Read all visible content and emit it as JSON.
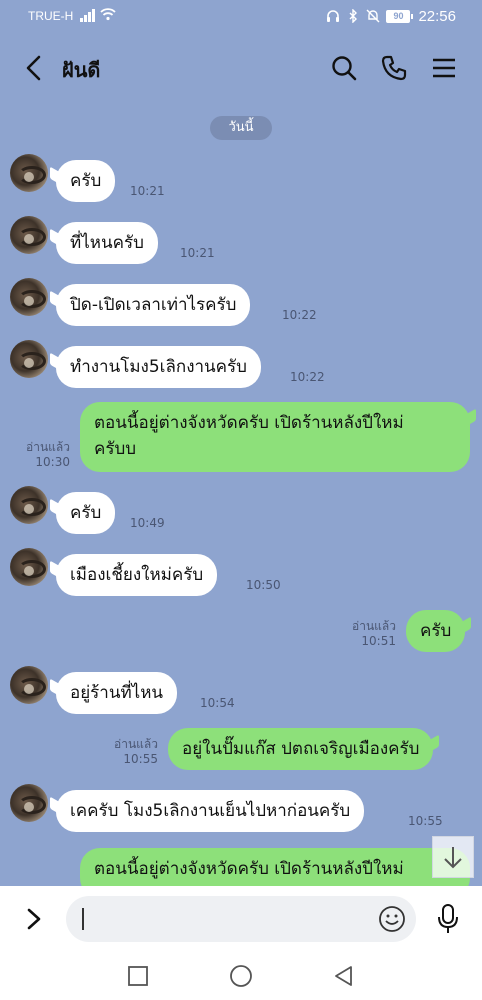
{
  "status_bar": {
    "carrier": "TRUE-H",
    "battery": "90",
    "time": "22:56"
  },
  "header": {
    "title": "ฝันดี"
  },
  "date_chip": "วันนี้",
  "messages": [
    {
      "dir": "in",
      "text": "ครับ",
      "time": "10:21"
    },
    {
      "dir": "in",
      "text": "ที่ไหนครับ",
      "time": "10:21"
    },
    {
      "dir": "in",
      "text": "ปิด-เปิดเวลาเท่าไรครับ",
      "time": "10:22"
    },
    {
      "dir": "in",
      "text": "ทำงานโมง5เลิกงานครับ",
      "time": "10:22"
    },
    {
      "dir": "out",
      "line1": "ตอนนี้อยู่ต่างจังหวัดครับ เปิดร้านหลังปีใหม่",
      "line2": "ครับบ",
      "read": "อ่านแล้ว",
      "time": "10:30"
    },
    {
      "dir": "in",
      "text": "ครับ",
      "time": "10:49"
    },
    {
      "dir": "in",
      "text": "เมืองเชี้ยงใหม่ครับ",
      "time": "10:50"
    },
    {
      "dir": "out",
      "text": "ครับ",
      "read": "อ่านแล้ว",
      "time": "10:51"
    },
    {
      "dir": "in",
      "text": "อยู่ร้านที่ไหน",
      "time": "10:54"
    },
    {
      "dir": "out",
      "text": "อยู่ในปั๊มแก๊ส ปตถเจริญเมืองครับ",
      "read": "อ่านแล้ว",
      "time": "10:55"
    },
    {
      "dir": "in",
      "text": "เคครับ โมง5เลิกงานเย็นไปหาก่อนครับ",
      "time": "10:55"
    },
    {
      "dir": "out",
      "text": "ตอนนี้อยู่ต่างจังหวัดครับ เปิดร้านหลังปีใหม่"
    }
  ],
  "input": {
    "placeholder": ""
  },
  "colors": {
    "background": "#8ea4cf",
    "incoming_bubble": "#ffffff",
    "outgoing_bubble": "#8de07a"
  }
}
